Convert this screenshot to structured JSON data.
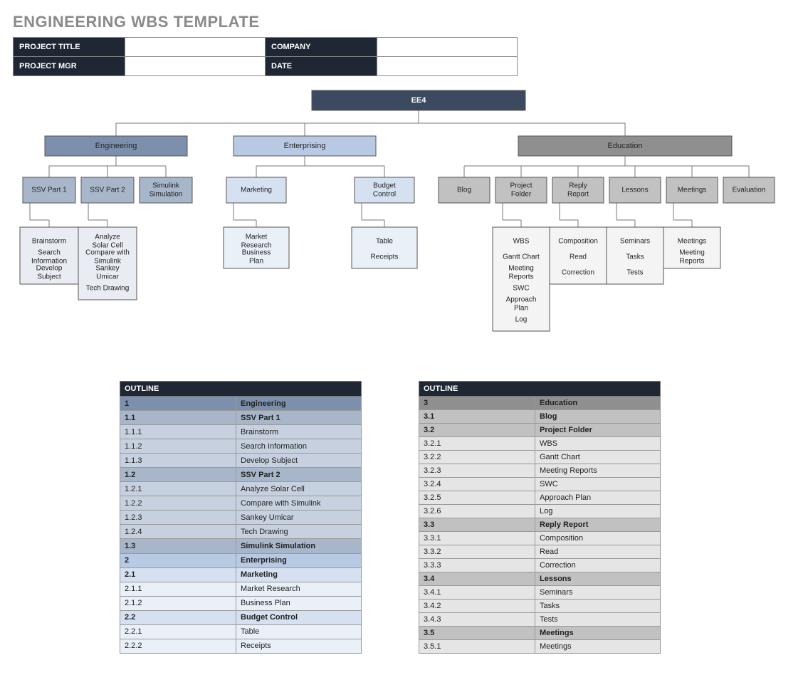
{
  "title": "ENGINEERING WBS TEMPLATE",
  "meta": {
    "k1": "PROJECT TITLE",
    "v1": "",
    "k2": "COMPANY",
    "v2": "",
    "k3": "PROJECT MGR",
    "v3": "",
    "k4": "DATE",
    "v4": ""
  },
  "palette": {
    "root": "#3b4a60",
    "eng": {
      "l1": "#7c90ad",
      "l2": "#a8b6ca",
      "l3": "#cdd6e2",
      "l3fill": "#e9edf3"
    },
    "ent": {
      "l1": "#b8c9e4",
      "l2": "#d5e1f0",
      "l3": "#e9f0f8"
    },
    "edu": {
      "l1": "#8f8f8f",
      "l2": "#c1c1c1",
      "l3": "#e5e5e5",
      "l3fill": "#f4f4f4"
    }
  },
  "wbs": {
    "root": "EE4",
    "branches": [
      {
        "name": "Engineering",
        "color": "eng",
        "children": [
          {
            "name": "SSV Part 1",
            "tasks": [
              "Brainstorm",
              "Search Information",
              "Develop Subject"
            ]
          },
          {
            "name": "SSV Part 2",
            "tasks": [
              "Analyze Solar Cell",
              "Compare with Simulink",
              "Sankey Umicar",
              "Tech Drawing"
            ]
          },
          {
            "name": "Simulink Simulation",
            "tasks": []
          }
        ]
      },
      {
        "name": "Enterprising",
        "color": "ent",
        "children": [
          {
            "name": "Marketing",
            "tasks": [
              "Market Research",
              "Business Plan"
            ]
          },
          {
            "name": "Budget Control",
            "tasks": [
              "Table",
              "Receipts"
            ]
          }
        ]
      },
      {
        "name": "Education",
        "color": "edu",
        "children": [
          {
            "name": "Blog",
            "tasks": []
          },
          {
            "name": "Project Folder",
            "tasks": [
              "WBS",
              "Gantt Chart",
              "Meeting Reports",
              "SWC",
              "Approach Plan",
              "Log"
            ]
          },
          {
            "name": "Reply Report",
            "tasks": [
              "Composition",
              "Read",
              "Correction"
            ]
          },
          {
            "name": "Lessons",
            "tasks": [
              "Seminars",
              "Tasks",
              "Tests"
            ]
          },
          {
            "name": "Meetings",
            "tasks": [
              "Meetings",
              "Meeting Reports"
            ]
          },
          {
            "name": "Evaluation",
            "tasks": []
          }
        ]
      }
    ]
  },
  "outlineHeader": "OUTLINE",
  "outline1": [
    {
      "n": "1",
      "t": "Engineering",
      "lvl": 1,
      "c": "c-eng1"
    },
    {
      "n": "1.1",
      "t": "SSV Part 1",
      "lvl": 2,
      "c": "c-eng2"
    },
    {
      "n": "1.1.1",
      "t": "Brainstorm",
      "lvl": 3,
      "c": "c-eng3"
    },
    {
      "n": "1.1.2",
      "t": "Search Information",
      "lvl": 3,
      "c": "c-eng3"
    },
    {
      "n": "1.1.3",
      "t": "Develop Subject",
      "lvl": 3,
      "c": "c-eng3"
    },
    {
      "n": "1.2",
      "t": "SSV Part 2",
      "lvl": 2,
      "c": "c-eng2"
    },
    {
      "n": "1.2.1",
      "t": "Analyze Solar Cell",
      "lvl": 3,
      "c": "c-eng3"
    },
    {
      "n": "1.2.2",
      "t": "Compare with Simulink",
      "lvl": 3,
      "c": "c-eng3"
    },
    {
      "n": "1.2.3",
      "t": "Sankey Umicar",
      "lvl": 3,
      "c": "c-eng3"
    },
    {
      "n": "1.2.4",
      "t": "Tech Drawing",
      "lvl": 3,
      "c": "c-eng3"
    },
    {
      "n": "1.3",
      "t": "Simulink Simulation",
      "lvl": 2,
      "c": "c-eng2"
    },
    {
      "n": "2",
      "t": "Enterprising",
      "lvl": 1,
      "c": "c-ent1"
    },
    {
      "n": "2.1",
      "t": "Marketing",
      "lvl": 2,
      "c": "c-ent2"
    },
    {
      "n": "2.1.1",
      "t": "Market Research",
      "lvl": 3,
      "c": "c-ent3"
    },
    {
      "n": "2.1.2",
      "t": "Business Plan",
      "lvl": 3,
      "c": "c-ent3"
    },
    {
      "n": "2.2",
      "t": "Budget Control",
      "lvl": 2,
      "c": "c-ent2"
    },
    {
      "n": "2.2.1",
      "t": "Table",
      "lvl": 3,
      "c": "c-ent3"
    },
    {
      "n": "2.2.2",
      "t": "Receipts",
      "lvl": 3,
      "c": "c-ent3"
    }
  ],
  "outline2": [
    {
      "n": "3",
      "t": "Education",
      "lvl": 1,
      "c": "c-edu1"
    },
    {
      "n": "3.1",
      "t": "Blog",
      "lvl": 2,
      "c": "c-edu2"
    },
    {
      "n": "3.2",
      "t": "Project Folder",
      "lvl": 2,
      "c": "c-edu2"
    },
    {
      "n": "3.2.1",
      "t": "WBS",
      "lvl": 3,
      "c": "c-edu3"
    },
    {
      "n": "3.2.2",
      "t": "Gantt Chart",
      "lvl": 3,
      "c": "c-edu3"
    },
    {
      "n": "3.2.3",
      "t": "Meeting Reports",
      "lvl": 3,
      "c": "c-edu3"
    },
    {
      "n": "3.2.4",
      "t": "SWC",
      "lvl": 3,
      "c": "c-edu3"
    },
    {
      "n": "3.2.5",
      "t": "Approach Plan",
      "lvl": 3,
      "c": "c-edu3"
    },
    {
      "n": "3.2.6",
      "t": "Log",
      "lvl": 3,
      "c": "c-edu3"
    },
    {
      "n": "3.3",
      "t": "Reply Report",
      "lvl": 2,
      "c": "c-edu2"
    },
    {
      "n": "3.3.1",
      "t": "Composition",
      "lvl": 3,
      "c": "c-edu3"
    },
    {
      "n": "3.3.2",
      "t": "Read",
      "lvl": 3,
      "c": "c-edu3"
    },
    {
      "n": "3.3.3",
      "t": "Correction",
      "lvl": 3,
      "c": "c-edu3"
    },
    {
      "n": "3.4",
      "t": "Lessons",
      "lvl": 2,
      "c": "c-edu2"
    },
    {
      "n": "3.4.1",
      "t": "Seminars",
      "lvl": 3,
      "c": "c-edu3"
    },
    {
      "n": "3.4.2",
      "t": "Tasks",
      "lvl": 3,
      "c": "c-edu3"
    },
    {
      "n": "3.4.3",
      "t": "Tests",
      "lvl": 3,
      "c": "c-edu3"
    },
    {
      "n": "3.5",
      "t": "Meetings",
      "lvl": 2,
      "c": "c-edu2"
    },
    {
      "n": "3.5.1",
      "t": "Meetings",
      "lvl": 3,
      "c": "c-edu3"
    }
  ]
}
